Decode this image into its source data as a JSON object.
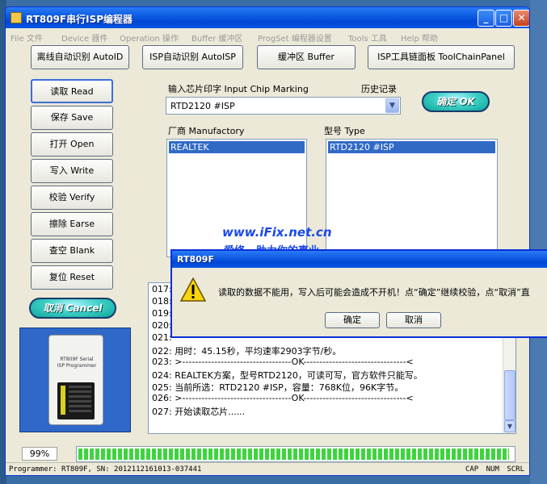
{
  "window": {
    "title": "RT809F串行ISP编程器",
    "minimize": "_",
    "maximize": "□",
    "close": "✕"
  },
  "menu": [
    "File 文件",
    "Device 器件",
    "Operation 操作",
    "Buffer 缓冲区",
    "ProgSet 编程器设置",
    "Tools 工具",
    "Help 帮助"
  ],
  "toolbar": [
    "离线自动识别 AutoID",
    "ISP自动识别 AutoISP",
    "缓冲区 Buffer",
    "ISP工具链面板 ToolChainPanel"
  ],
  "side_buttons": [
    "读取 Read",
    "保存 Save",
    "打开 Open",
    "写入 Write",
    "校验 Verify",
    "擦除 Earse",
    "查空 Blank",
    "复位 Reset"
  ],
  "cancel_label": "取消 Cancel",
  "ok_label": "确定 OK",
  "chip_marking": {
    "label": "输入芯片印字 Input Chip Marking",
    "history_label": "历史记录",
    "value": "RTD2120 #ISP"
  },
  "manufactory": {
    "label": "厂商 Manufactory",
    "selected": "REALTEK"
  },
  "type": {
    "label": "型号 Type",
    "selected": "RTD2120 #ISP"
  },
  "watermark": {
    "line1": "www.iFix.net.cn",
    "line2": "爱修 . 助力你的事业"
  },
  "device_photo": {
    "text": "RT809F Serial ISP Programmer"
  },
  "log_lines": [
    "017:",
    "018:",
    "019:",
    "020:",
    "021:",
    "022: 用时：45.15秒，平均速率2903字节/秒。",
    "023: >----------------------------------OK--------------------------------<",
    "024: REALTEK方案，型号RTD2120，可读可写，官方软件只能写。",
    "025: 当前所选：RTD2120 #ISP，容量：768K位，96K字节。",
    "026: >----------------------------------OK--------------------------------<",
    "027: 开始读取芯片......"
  ],
  "progress": {
    "label": "99%",
    "value": 99
  },
  "status": {
    "programmer": "Programmer: RT809F, SN: 2012112161013-037441",
    "flags": "CAP NUM SCRL"
  },
  "dialog": {
    "title": "RT809F",
    "message": "读取的数据不能用，写入后可能会造成不开机！点“确定”继续校验，点“取消”直",
    "ok": "确定",
    "cancel": "取消"
  },
  "colors": {
    "title_blue": "#0a5ae0",
    "selection": "#316ac5",
    "progress_green": "#3ed43e",
    "accent_teal": "#0aa59a"
  }
}
